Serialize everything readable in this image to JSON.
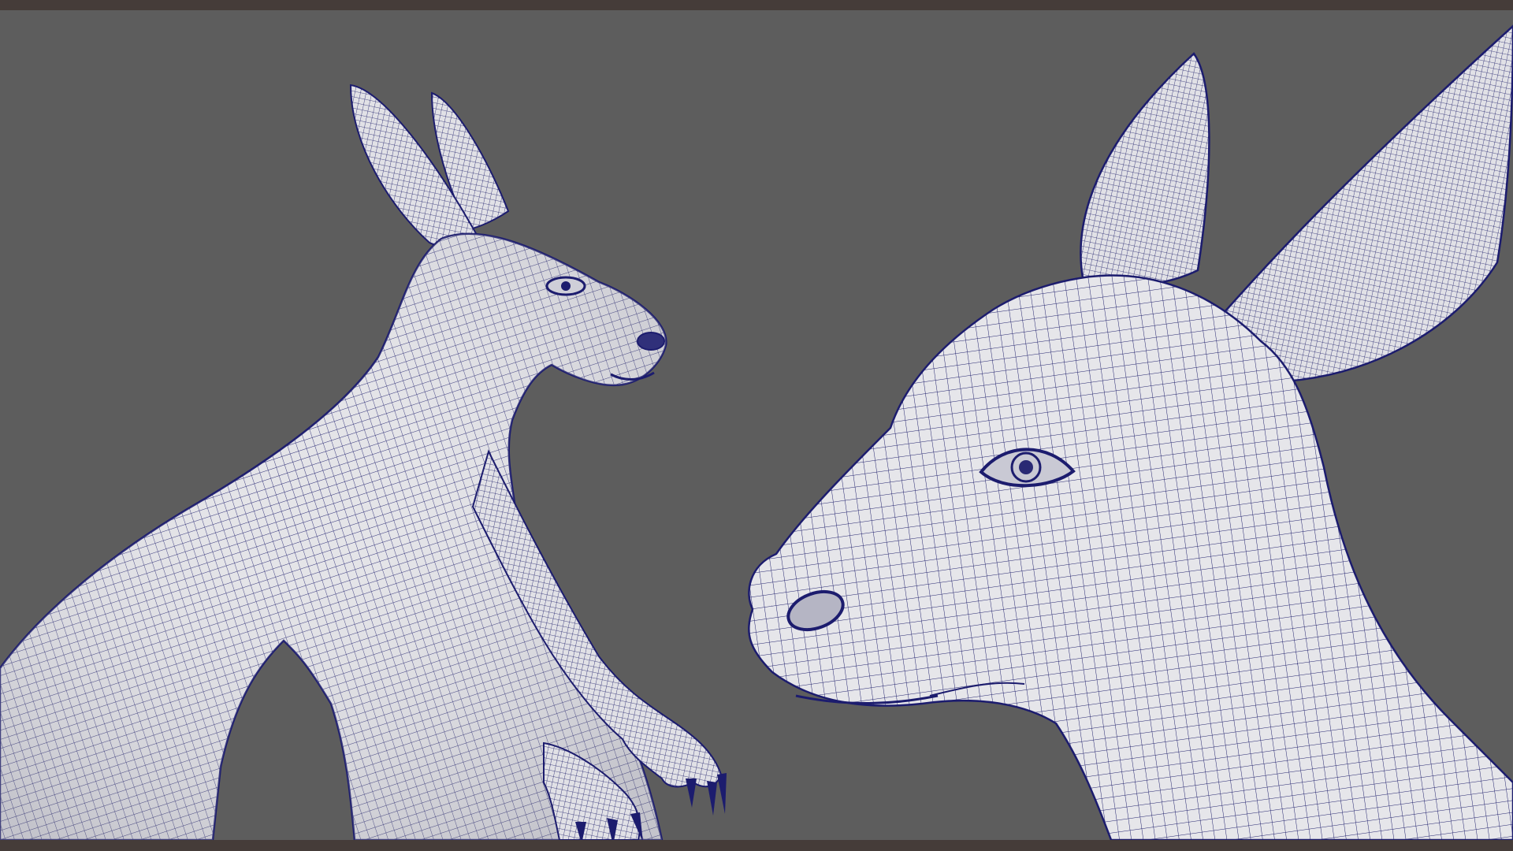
{
  "scene": {
    "subject": "kangaroo-wireframe",
    "background_color": "#5d5d5d",
    "frame_color": "#453c39",
    "mesh_fill": "#e3e3e6",
    "mesh_line": "#1c1c6e"
  },
  "watermarks": {
    "left": "",
    "right": "",
    "center": ""
  }
}
